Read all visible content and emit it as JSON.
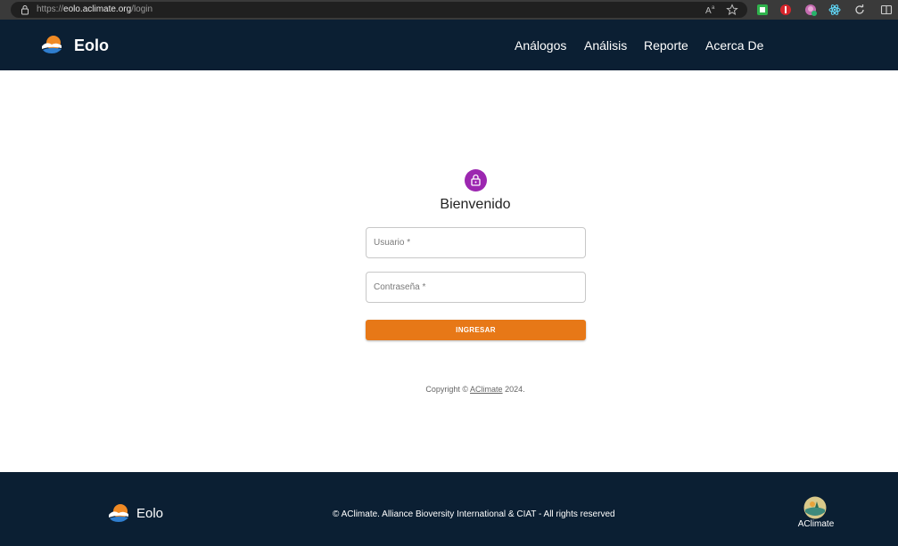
{
  "browser": {
    "url_protocol": "https://",
    "url_host": "eolo.aclimate.org",
    "url_path": "/login",
    "icons": [
      "lock-icon",
      "read-aloud-icon",
      "favorite-star-icon",
      "extension-green-icon",
      "extension-red-icon",
      "extension-avatar-icon",
      "extension-react-icon",
      "refresh-icon",
      "split-screen-icon"
    ]
  },
  "header": {
    "brand": "Eolo",
    "nav": [
      "Análogos",
      "Análisis",
      "Reporte",
      "Acerca De"
    ]
  },
  "login": {
    "title": "Bienvenido",
    "username_placeholder": "Usuario *",
    "password_placeholder": "Contraseña *",
    "submit_label": "INGRESAR",
    "copyright_prefix": "Copyright © ",
    "copyright_link": "AClimate",
    "copyright_suffix": " 2024."
  },
  "footer": {
    "brand": "Eolo",
    "copyright": "© AClimate. Alliance Bioversity International & CIAT - All rights reserved",
    "partner": "AClimate"
  },
  "colors": {
    "navy": "#0b1f33",
    "accent_orange": "#e77817",
    "lock_purple": "#9c27b0"
  }
}
